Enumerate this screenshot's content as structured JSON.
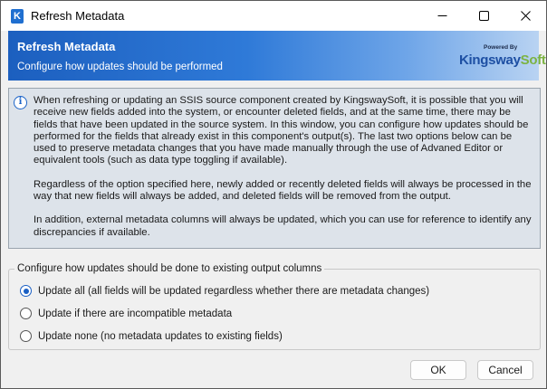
{
  "window": {
    "title": "Refresh Metadata",
    "app_icon_letter": "K",
    "controls": [
      "minimize-icon",
      "maximize-icon",
      "close-icon"
    ]
  },
  "banner": {
    "title": "Refresh Metadata",
    "subtitle": "Configure how updates should be performed",
    "brand_powered": "Powered By",
    "brand_kingsway": "Kingsway",
    "brand_soft": "Soft"
  },
  "info": {
    "icon": "info-icon",
    "paragraphs": [
      "When refreshing or updating an SSIS source component created by KingswaySoft, it is possible that you will receive new fields added into the system, or encounter deleted fields, and at the same time, there may be fields that have been updated in the source system. In this window, you can configure how updates should be performed for the fields that already exist in this component's output(s). The last two options below can be used to preserve metadata changes that you have made manually through the use of Advaned Editor or equivalent tools (such as data type toggling if available).",
      "Regardless of the option specified here, newly added or recently deleted fields will always be processed in the way that new fields will always be added, and deleted fields will be removed from the output.",
      "In addition, external metadata columns will always be updated, which you can use for reference to identify any discrepancies if available."
    ]
  },
  "options": {
    "legend": "Configure how updates should be done to existing output columns",
    "items": [
      {
        "label": "Update all (all fields will be updated regardless whether there are metadata changes)",
        "selected": true
      },
      {
        "label": "Update if there are incompatible metadata",
        "selected": false
      },
      {
        "label": "Update none (no metadata updates to existing fields)",
        "selected": false
      }
    ]
  },
  "buttons": {
    "ok": "OK",
    "cancel": "Cancel"
  }
}
